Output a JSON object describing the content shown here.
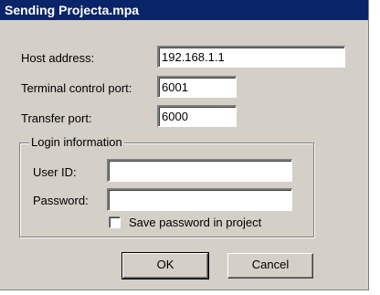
{
  "window": {
    "title": "Sending Projecta.mpa"
  },
  "form": {
    "host_label": "Host address:",
    "host_value": "192.168.1.1",
    "terminal_port_label": "Terminal control port:",
    "terminal_port_value": "6001",
    "transfer_port_label": "Transfer port:",
    "transfer_port_value": "6000"
  },
  "login": {
    "group_title": "Login information",
    "user_label": "User ID:",
    "user_value": "",
    "password_label": "Password:",
    "password_value": "",
    "save_password_label": "Save password in project",
    "save_password_checked": false
  },
  "buttons": {
    "ok": "OK",
    "cancel": "Cancel"
  },
  "colors": {
    "titlebar": "#0a246a",
    "face": "#d4d0c8",
    "field": "#ffffff"
  }
}
